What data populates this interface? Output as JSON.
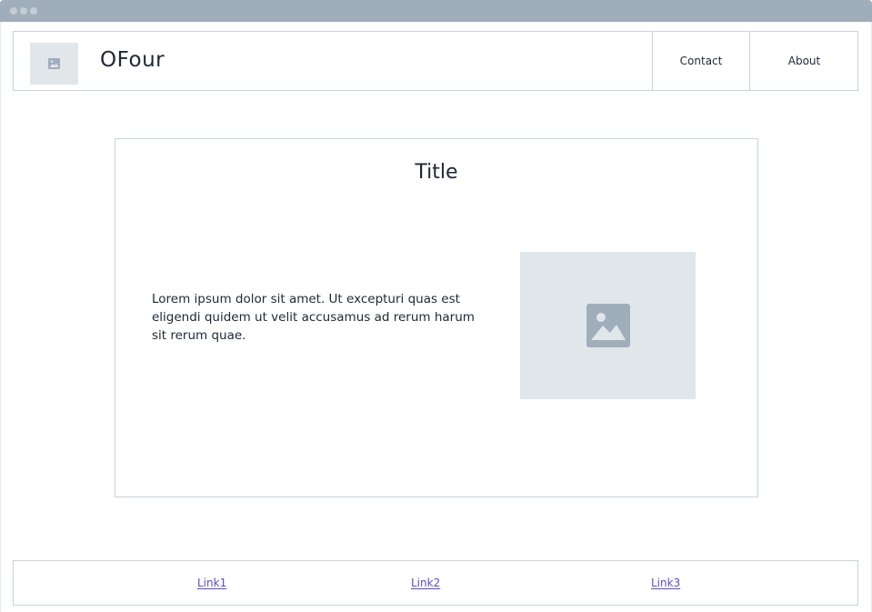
{
  "header": {
    "brand": "OFour",
    "nav": [
      {
        "label": "Contact"
      },
      {
        "label": "About"
      }
    ]
  },
  "main": {
    "title": "Title",
    "body_text": "Lorem ipsum dolor sit amet. Ut excepturi quas est eligendi quidem ut velit accusamus ad rerum harum sit rerum quae."
  },
  "footer": {
    "links": [
      {
        "label": "Link1"
      },
      {
        "label": "Link2"
      },
      {
        "label": "Link3"
      }
    ]
  },
  "colors": {
    "titlebar": "#a0adbb",
    "placeholder_bg": "#e1e6eb",
    "placeholder_icon": "#a0adbb",
    "border": "#c9d2dc",
    "link": "#5a4fc8"
  },
  "icons": {
    "logo": "image-placeholder-icon",
    "card_image": "image-placeholder-icon"
  }
}
